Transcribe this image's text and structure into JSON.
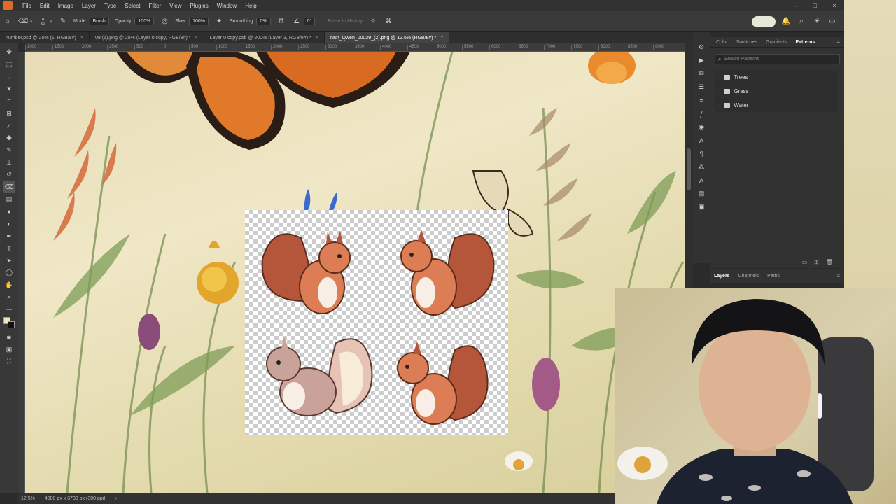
{
  "app": {
    "name": "Photoshop",
    "accent": "#e06a2a"
  },
  "menu": [
    "File",
    "Edit",
    "Image",
    "Layer",
    "Type",
    "Select",
    "Filter",
    "View",
    "Plugins",
    "Window",
    "Help"
  ],
  "window_controls": [
    "–",
    "□",
    "×"
  ],
  "options": {
    "brush_size": "60",
    "mode_label": "Mode:",
    "mode_value": "Brush",
    "opacity_label": "Opacity:",
    "opacity_value": "100%",
    "flow_label": "Flow:",
    "flow_value": "100%",
    "smoothing_label": "Smoothing:",
    "smoothing_value": "0%",
    "angle_value": "0°",
    "erase_history": "Erase to History"
  },
  "tabs": [
    {
      "label": "number.psd @ 25% (1, RGB/8#)",
      "active": false
    },
    {
      "label": "09 (5).png @ 25% (Layer 0 copy, RGB/8#) *",
      "active": false
    },
    {
      "label": "Layer 0 copy.psb @ 200% (Layer 3, RGB/8#) *",
      "active": false
    },
    {
      "label": "Nun_Qwen_00029_(2).png @ 12.5% (RGB/8#) *",
      "active": true
    }
  ],
  "ruler_ticks": [
    "1000",
    "1500",
    "2000",
    "2500",
    "500",
    "0",
    "500",
    "1000",
    "1500",
    "2000",
    "2500",
    "3000",
    "3500",
    "4000",
    "4500",
    "5000",
    "5500",
    "6000",
    "6500",
    "7000",
    "7500",
    "8000",
    "8500",
    "9000"
  ],
  "status": {
    "zoom": "12.5%",
    "doc_info": "4800 px x 3733 px (300 ppi)"
  },
  "panel": {
    "tabs": [
      "Color",
      "Swatches",
      "Gradients",
      "Patterns"
    ],
    "active_tab": "Patterns",
    "search_placeholder": "Search Patterns",
    "folders": [
      "Trees",
      "Grass",
      "Water"
    ]
  },
  "layers_panel": {
    "tabs": [
      "Layers",
      "Channels",
      "Paths"
    ]
  },
  "colors": {
    "foreground": "#f3e3c3",
    "background": "#111111"
  },
  "icons": [
    "home-icon",
    "eraser-icon",
    "brush-preset-icon",
    "toggle-brush-panel-icon",
    "airbrush-icon",
    "settings-gear-icon",
    "angle-icon",
    "erase-history-icon",
    "pressure-icon",
    "bell-icon",
    "search-icon",
    "lightbulb-icon",
    "workspace-icon",
    "panel-menu-icon"
  ]
}
